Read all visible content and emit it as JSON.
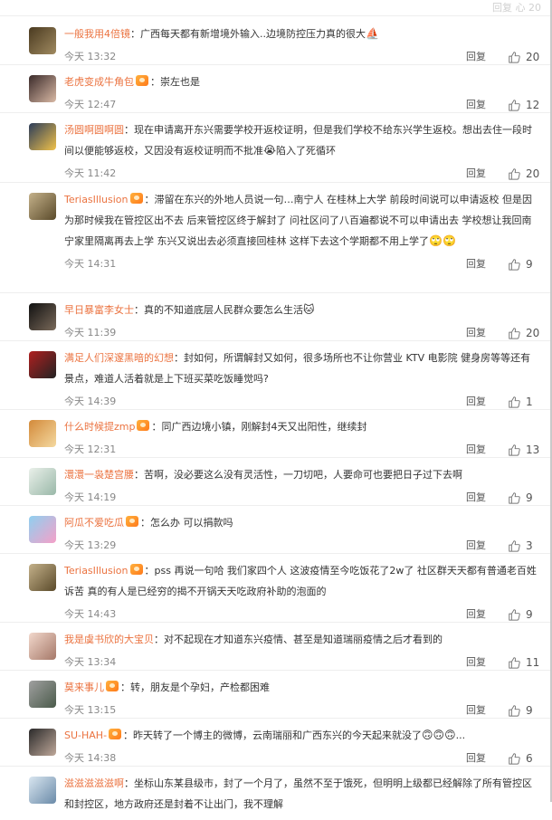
{
  "ghost_text": "回复   心 20",
  "comments": [
    {
      "user": "一般我用4倍镜",
      "vip": false,
      "content": "广西每天都有新增境外输入..边境防控压力真的很大",
      "emoji": "⛵",
      "time": "今天 13:32",
      "reply": "回复",
      "likes": "20"
    },
    {
      "user": "老虎变成牛角包",
      "vip": true,
      "content": "崇左也是",
      "emoji": "",
      "time": "今天 12:47",
      "reply": "回复",
      "likes": "12"
    },
    {
      "user": "汤圆啊圆啊圆",
      "vip": false,
      "content": "现在申请离开东兴需要学校开返校证明，但是我们学校不给东兴学生返校。想出去住一段时间以便能够返校，又因没有返校证明而不批准",
      "emoji": "😭",
      "content2": "陷入了死循环",
      "time": "今天 11:42",
      "reply": "回复",
      "likes": "20"
    },
    {
      "user": "TeriasIllusion",
      "vip": true,
      "content": "滞留在东兴的外地人员说一句…南宁人 在桂林上大学 前段时间说可以申请返校 但是因为那时候我在管控区出不去 后来管控区终于解封了 问社区问了八百遍都说不可以申请出去 学校想让我回南宁家里隔离再去上学 东兴又说出去必须直接回桂林 这样下去这个学期都不用上学了",
      "emoji": "🙄🙄",
      "time": "今天 14:31",
      "reply": "回复",
      "likes": "9"
    },
    {
      "user": "早日暴富李女士",
      "vip": false,
      "content": "真的不知道底层人民群众要怎么生活",
      "emoji": "🐱",
      "time": "今天 11:39",
      "reply": "回复",
      "likes": "20"
    },
    {
      "user": "满足人们深邃黑暗的幻想",
      "vip": false,
      "content": "封如何，所谓解封又如何，很多场所也不让你营业 KTV 电影院 健身房等等还有景点，难道人活着就是上下班买菜吃饭睡觉吗?",
      "emoji": "",
      "time": "今天 14:39",
      "reply": "回复",
      "likes": "1"
    },
    {
      "user": "什么时候提zmp",
      "vip": true,
      "content": "同广西边境小镇，刚解封4天又出阳性，继续封",
      "emoji": "",
      "time": "今天 12:31",
      "reply": "回复",
      "likes": "13"
    },
    {
      "user": "澴澴一袅楚宫腰",
      "vip": false,
      "content": "苦啊，没必要这么没有灵活性，一刀切吧，人要命可也要把日子过下去啊",
      "emoji": "",
      "time": "今天 14:19",
      "reply": "回复",
      "likes": "9"
    },
    {
      "user": "阿瓜不爱吃瓜",
      "vip": true,
      "content": "怎么办 可以捐款吗",
      "emoji": "",
      "time": "今天 13:29",
      "reply": "回复",
      "likes": "3"
    },
    {
      "user": "TeriasIllusion",
      "vip": true,
      "content": "pss 再说一句哈 我们家四个人 这波疫情至今吃饭花了2w了 社区群天天都有普通老百姓诉苦 真的有人是已经穷的揭不开锅天天吃政府补助的泡面的",
      "emoji": "",
      "time": "今天 14:43",
      "reply": "回复",
      "likes": "9"
    },
    {
      "user": "我是虞书欣的大宝贝",
      "vip": false,
      "content": "对不起现在才知道东兴疫情、甚至是知道瑞丽疫情之后才看到的",
      "emoji": "",
      "time": "今天 13:34",
      "reply": "回复",
      "likes": "11"
    },
    {
      "user": "莫来事儿",
      "vip": true,
      "content": "转，朋友是个孕妇，产检都困难",
      "emoji": "",
      "time": "今天 13:15",
      "reply": "回复",
      "likes": "9"
    },
    {
      "user": "SU-HAH-",
      "vip": true,
      "content": "昨天转了一个博主的微博，云南瑞丽和广西东兴的今天起来就没了",
      "emoji": "🙃🙃🙃",
      "content2": "...",
      "time": "今天 14:38",
      "reply": "回复",
      "likes": "6"
    },
    {
      "user": "滋滋滋滋滋啊",
      "vip": false,
      "content": "坐标山东某县级市，封了一个月了，虽然不至于饿死，但明明上级都已经解除了所有管控区和封控区，地方政府还是封着不让出门，我不理解",
      "emoji": "",
      "time": "",
      "reply": "",
      "likes": ""
    }
  ],
  "colors": {
    "username": "#eb7340",
    "text": "#333333",
    "meta": "#888888",
    "divider": "#eeeeee"
  }
}
